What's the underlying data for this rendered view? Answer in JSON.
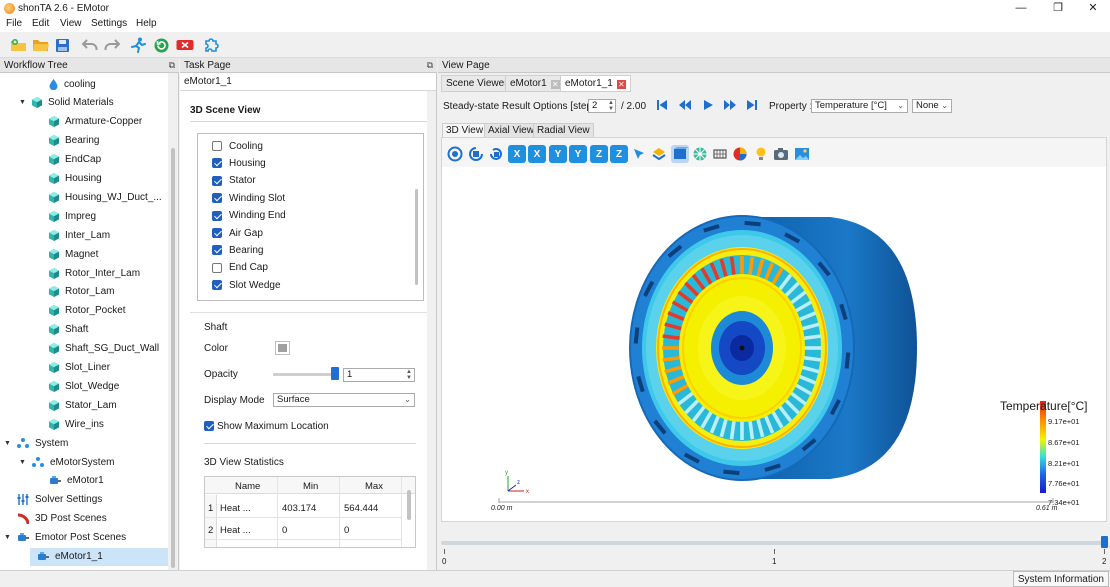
{
  "window": {
    "title": "shonTA 2.6 - EMotor",
    "controls": [
      "—",
      "❐",
      "✕"
    ]
  },
  "menu": [
    "File",
    "Edit",
    "View",
    "Settings",
    "Help"
  ],
  "panels": {
    "workflow": "Workflow Tree",
    "task": "Task Page",
    "view": "View Page"
  },
  "workflow_tree": [
    {
      "label": "cooling",
      "indent": 3,
      "icon": "drop-icon"
    },
    {
      "label": "Solid Materials",
      "indent": 2,
      "icon": "cube-icon",
      "expanded": true
    },
    {
      "label": "Armature-Copper",
      "indent": 3,
      "icon": "cube-icon"
    },
    {
      "label": "Bearing",
      "indent": 3,
      "icon": "cube-icon"
    },
    {
      "label": "EndCap",
      "indent": 3,
      "icon": "cube-icon"
    },
    {
      "label": "Housing",
      "indent": 3,
      "icon": "cube-icon"
    },
    {
      "label": "Housing_WJ_Duct_...",
      "indent": 3,
      "icon": "cube-icon"
    },
    {
      "label": "Impreg",
      "indent": 3,
      "icon": "cube-icon"
    },
    {
      "label": "Inter_Lam",
      "indent": 3,
      "icon": "cube-icon"
    },
    {
      "label": "Magnet",
      "indent": 3,
      "icon": "cube-icon"
    },
    {
      "label": "Rotor_Inter_Lam",
      "indent": 3,
      "icon": "cube-icon"
    },
    {
      "label": "Rotor_Lam",
      "indent": 3,
      "icon": "cube-icon"
    },
    {
      "label": "Rotor_Pocket",
      "indent": 3,
      "icon": "cube-icon"
    },
    {
      "label": "Shaft",
      "indent": 3,
      "icon": "cube-icon"
    },
    {
      "label": "Shaft_SG_Duct_Wall",
      "indent": 3,
      "icon": "cube-icon"
    },
    {
      "label": "Slot_Liner",
      "indent": 3,
      "icon": "cube-icon"
    },
    {
      "label": "Slot_Wedge",
      "indent": 3,
      "icon": "cube-icon"
    },
    {
      "label": "Stator_Lam",
      "indent": 3,
      "icon": "cube-icon"
    },
    {
      "label": "Wire_ins",
      "indent": 3,
      "icon": "cube-icon"
    },
    {
      "label": "System",
      "indent": 1,
      "icon": "system-icon",
      "expanded": true
    },
    {
      "label": "eMotorSystem",
      "indent": 2,
      "icon": "system-icon",
      "expanded": true
    },
    {
      "label": "eMotor1",
      "indent": 3,
      "icon": "motor-icon"
    },
    {
      "label": "Solver Settings",
      "indent": 1,
      "icon": "settings-icon"
    },
    {
      "label": "3D Post Scenes",
      "indent": 1,
      "icon": "post-icon"
    },
    {
      "label": "Emotor Post Scenes",
      "indent": 1,
      "icon": "motor-icon",
      "expanded": true
    },
    {
      "label": "eMotor1_1",
      "indent": 2,
      "icon": "motor-icon",
      "selected": true
    }
  ],
  "task": {
    "breadcrumb": "eMotor1_1",
    "section_title": "3D Scene View",
    "parts": [
      {
        "label": "Cooling",
        "checked": false
      },
      {
        "label": "Housing",
        "checked": true
      },
      {
        "label": "Stator",
        "checked": true
      },
      {
        "label": "Winding Slot",
        "checked": true
      },
      {
        "label": "Winding End",
        "checked": true
      },
      {
        "label": "Air Gap",
        "checked": true
      },
      {
        "label": "Bearing",
        "checked": true
      },
      {
        "label": "End Cap",
        "checked": false
      },
      {
        "label": "Slot Wedge",
        "checked": true
      }
    ],
    "shaft": {
      "title": "Shaft",
      "color_label": "Color",
      "color": "#a0a0a0",
      "opacity_label": "Opacity",
      "opacity_value": "1",
      "opacity_fraction": 1.0,
      "display_mode_label": "Display Mode",
      "display_mode": "Surface",
      "show_max_label": "Show Maximum Location",
      "show_max": true
    },
    "stats": {
      "title": "3D View Statistics",
      "columns": [
        "Name",
        "Min",
        "Max"
      ],
      "rows": [
        {
          "index": "1",
          "name": "Heat ...",
          "min": "403.174",
          "max": "564.444"
        },
        {
          "index": "2",
          "name": "Heat ...",
          "min": "0",
          "max": "0"
        }
      ]
    }
  },
  "view": {
    "tabs": [
      {
        "label": "Scene Viewer",
        "close": false,
        "active": false
      },
      {
        "label": "eMotor1",
        "close": true,
        "active": false,
        "close_color": "#bdbdbd"
      },
      {
        "label": "eMotor1_1",
        "close": true,
        "active": true,
        "close_color": "#e04848"
      }
    ],
    "steady_label": "Steady-state Result Options [step]",
    "step_value": "2",
    "step_total": "/ 2.00",
    "property_label": "Property :",
    "property_value": "Temperature [°C]",
    "second_select": "None",
    "subtabs": [
      "3D View",
      "Axial View",
      "Radial View"
    ],
    "scene_icons": [
      "fit-icon",
      "rotate-icon",
      "reset-icon",
      "X",
      "X",
      "Y",
      "Y",
      "Z",
      "Z",
      "pick-icon",
      "clip-icon",
      "box-icon",
      "mesh-icon",
      "mesh-wire-icon",
      "color-icon",
      "light-icon",
      "camera-icon",
      "image-icon"
    ],
    "legend": {
      "title": "Temperature[°C]",
      "ticks": [
        "9.17e+01",
        "8.67e+01",
        "8.21e+01",
        "7.76e+01",
        "7.34e+01"
      ]
    },
    "scale": {
      "left": "0.00 m",
      "right": "0.61 m"
    },
    "timeline": {
      "ticks": [
        "0",
        "1",
        "2"
      ],
      "position": 1.0
    }
  },
  "status": {
    "text": "System Information"
  },
  "colors": {
    "accent": "#1f5fbf",
    "housing_blue": "#1f7fd0",
    "stator_cyan": "#39c6e8",
    "winding_yellow": "#f5f000",
    "winding_orange": "#ff9a00",
    "winding_red": "#e53a2a",
    "rotor_blue": "#1648c8"
  }
}
